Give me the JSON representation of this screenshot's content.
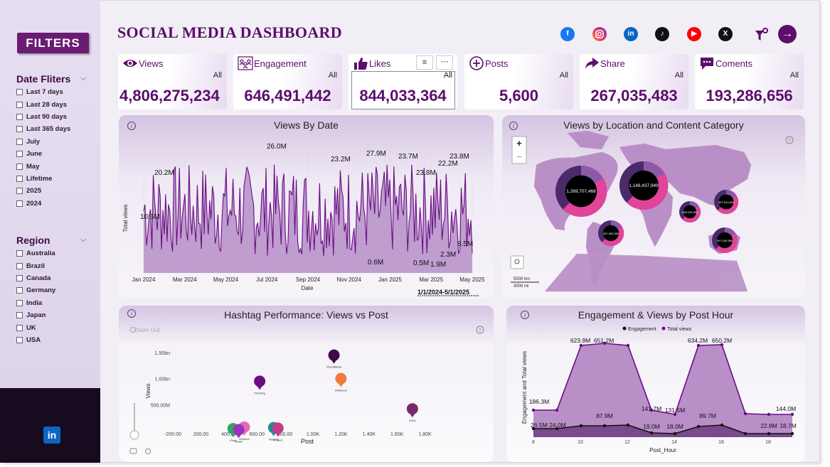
{
  "header": {
    "title": "SOCIAL MEDIA DASHBOARD",
    "social_icons": [
      "facebook-icon",
      "instagram-icon",
      "linkedin-icon",
      "tiktok-icon",
      "youtube-icon",
      "x-icon"
    ],
    "filter_icon": "filter-icon",
    "next_icon": "arrow-right-icon"
  },
  "sidebar": {
    "filters_label": "FILTERS",
    "date_filters_title": "Date Fliters",
    "date_options": [
      "Last 7 days",
      "Last 28 days",
      "Last 90 days",
      "Last 365 days",
      "July",
      "June",
      "May",
      "Lifetime",
      "2025",
      "2024"
    ],
    "region_title": "Region",
    "region_options": [
      "Australia",
      "Brazil",
      "Canada",
      "Germany",
      "India",
      "Japan",
      "UK",
      "USA"
    ],
    "footer_logo": "in"
  },
  "kpis": [
    {
      "label": "Views",
      "filter": "All",
      "value": "4,806,275,234",
      "icon": "eye-icon"
    },
    {
      "label": "Engagement",
      "filter": "All",
      "value": "646,491,442",
      "icon": "people-icon"
    },
    {
      "label": "Likes",
      "filter": "All",
      "value": "844,033,364",
      "icon": "thumbs-up-icon"
    },
    {
      "label": "Posts",
      "filter": "All",
      "value": "5,600",
      "icon": "plus-box-icon"
    },
    {
      "label": "Share",
      "filter": "All",
      "value": "267,035,483",
      "icon": "share-icon"
    },
    {
      "label": "Coments",
      "filter": "All",
      "value": "193,286,656",
      "icon": "comment-icon"
    }
  ],
  "colors": {
    "brand": "#5b0e6a",
    "series_purple": "#6a0d83",
    "area_fill": "#b98fc7",
    "pink": "#e0459a"
  },
  "chart_data": [
    {
      "type": "line",
      "title": "Views By Date",
      "xlabel": "Date",
      "ylabel": "Total views",
      "x_ticks": [
        "Jan 2024",
        "Mar 2024",
        "May 2024",
        "Jul 2024",
        "Sep 2024",
        "Nov 2024",
        "Jan 2025",
        "Mar 2025",
        "May 2025"
      ],
      "date_range_label": "1/1/2024-5/1/2025",
      "annotations": [
        "10.6M",
        "20.2M",
        "26.0M",
        "23.2M",
        "27.9M",
        "23.7M",
        "23.8M",
        "22.2M",
        "23.8M",
        "0.6M",
        "0.5M",
        "1.9M",
        "2.3M",
        "8.5M"
      ]
    },
    {
      "type": "map",
      "title": "Views by Location and Content Category",
      "bubble_labels": [
        "1,269,707,468",
        "1,146,437,949",
        "407,611,064",
        "408,029,556",
        "407,963,380",
        "507,150,565"
      ],
      "scale_km": "5000 km",
      "scale_mi": "3000 mi"
    },
    {
      "type": "scatter",
      "title": "Hashtag Performance: Views vs Post",
      "xlabel": "Post",
      "ylabel": "Views",
      "zoom_label": "Zoom Out",
      "x_ticks": [
        "-200.00",
        "200.00",
        "400.00",
        "600.00",
        "800.00",
        "1.00K",
        "1.20K",
        "1.40K",
        "1.60K",
        "1.80K"
      ],
      "y_ticks": [
        "500.00M",
        "1.00bn",
        "1.50bn"
      ],
      "points": [
        {
          "name": "#SocialMedia",
          "x": 950,
          "y": 1450000000,
          "color": "#3d0a4a"
        },
        {
          "name": "#Influencer",
          "x": 1000,
          "y": 1000000000,
          "color": "#f07a3a"
        },
        {
          "name": "#Trending",
          "x": 420,
          "y": 950000000,
          "color": "#6a0d83"
        },
        {
          "name": "#Viral",
          "x": 1510,
          "y": 420000000,
          "color": "#7a2a6a"
        },
        {
          "name": "#Tech",
          "x": 230,
          "y": 40000000,
          "color": "#2ca85c"
        },
        {
          "name": "#Fashion",
          "x": 310,
          "y": 70000000,
          "color": "#e46ab8"
        },
        {
          "name": "#Music",
          "x": 270,
          "y": 20000000,
          "color": "#9a30c0"
        },
        {
          "name": "#Gaming",
          "x": 520,
          "y": 60000000,
          "color": "#1f8c8c"
        },
        {
          "name": "#Fitness",
          "x": 550,
          "y": 50000000,
          "color": "#c23a8a"
        }
      ]
    },
    {
      "type": "area",
      "title": "Engagement & Views by Post Hour",
      "xlabel": "Post_Hour",
      "ylabel": "Engagement and Total views",
      "x_ticks": [
        "8",
        "10",
        "12",
        "14",
        "16",
        "18"
      ],
      "series": [
        {
          "name": "Engagement",
          "labels": [
            "26.5M",
            "24.0M",
            "87.9M",
            "19.0M",
            "18.0M",
            "89.7M",
            "22.8M",
            "18.7M"
          ]
        },
        {
          "name": "Total views",
          "labels": [
            "186.3M",
            "623.9M",
            "651.2M",
            "141.7M",
            "131.5M",
            "634.2M",
            "650.2M",
            "144.0M"
          ]
        }
      ]
    }
  ]
}
